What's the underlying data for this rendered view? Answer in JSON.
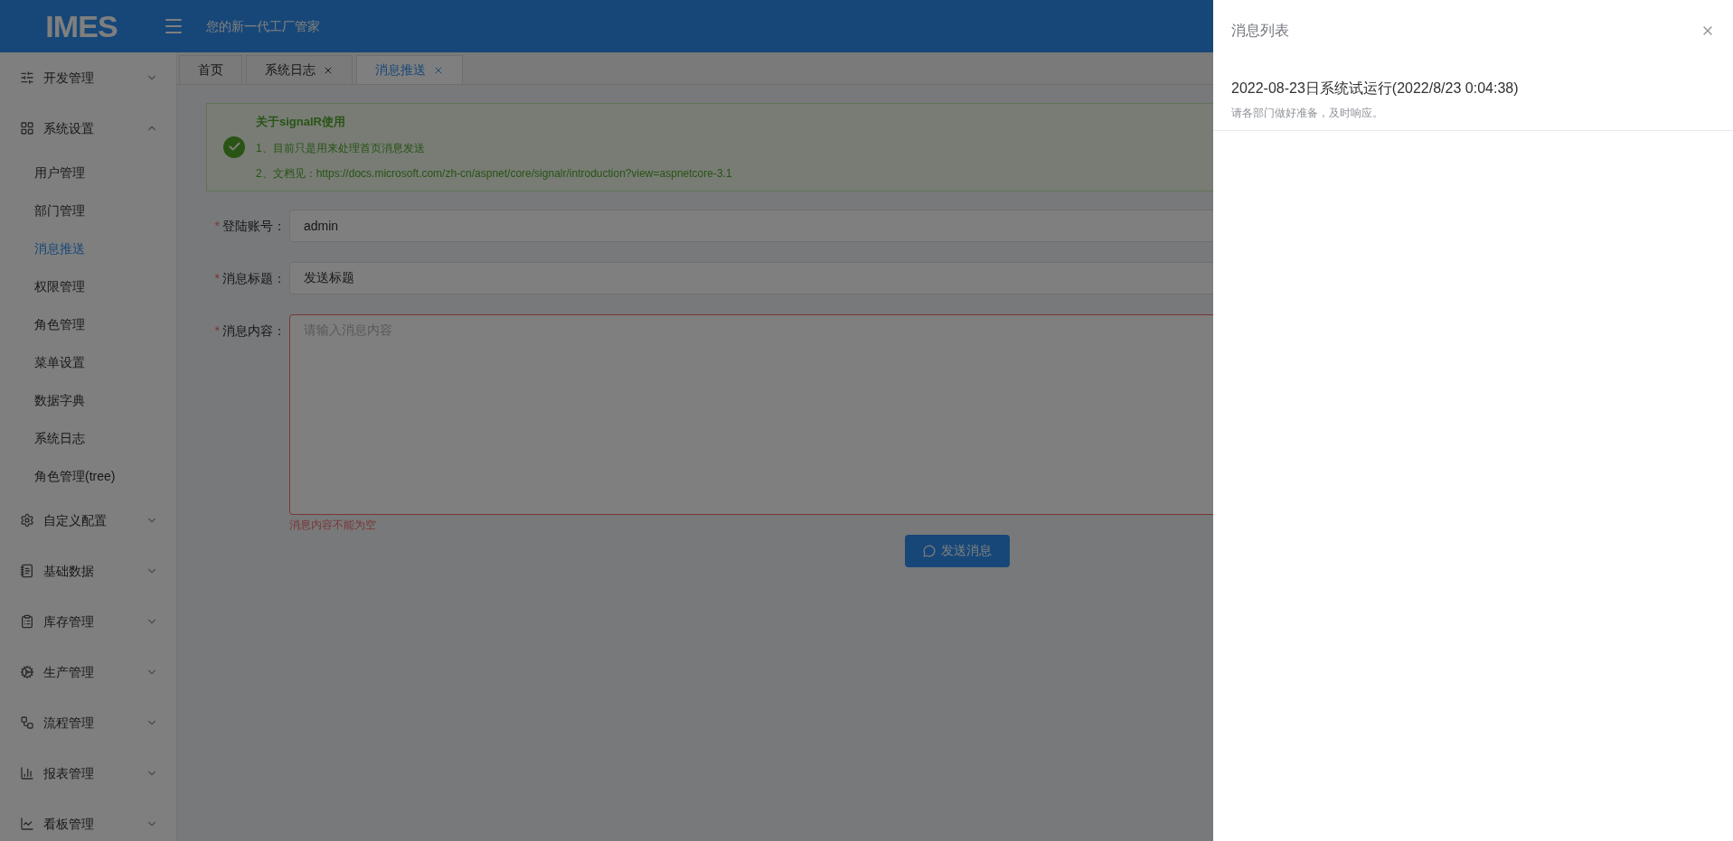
{
  "header": {
    "logo": "IMES",
    "tagline": "您的新一代工厂管家"
  },
  "sidebar": {
    "groups": [
      {
        "label": "开发管理",
        "expanded": false
      },
      {
        "label": "系统设置",
        "expanded": true,
        "children": [
          {
            "label": "用户管理",
            "selected": false
          },
          {
            "label": "部门管理",
            "selected": false
          },
          {
            "label": "消息推送",
            "selected": true
          },
          {
            "label": "权限管理",
            "selected": false
          },
          {
            "label": "角色管理",
            "selected": false
          },
          {
            "label": "菜单设置",
            "selected": false
          },
          {
            "label": "数据字典",
            "selected": false
          },
          {
            "label": "系统日志",
            "selected": false
          },
          {
            "label": "角色管理(tree)",
            "selected": false
          }
        ]
      },
      {
        "label": "自定义配置",
        "expanded": false
      },
      {
        "label": "基础数据",
        "expanded": false
      },
      {
        "label": "库存管理",
        "expanded": false
      },
      {
        "label": "生产管理",
        "expanded": false
      },
      {
        "label": "流程管理",
        "expanded": false
      },
      {
        "label": "报表管理",
        "expanded": false
      },
      {
        "label": "看板管理",
        "expanded": false
      }
    ]
  },
  "tabs": [
    {
      "label": "首页",
      "selected": false,
      "closable": false
    },
    {
      "label": "系统日志",
      "selected": false,
      "closable": true
    },
    {
      "label": "消息推送",
      "selected": true,
      "closable": true
    }
  ],
  "alert": {
    "title": "关于signalR使用",
    "lines": [
      {
        "text": "1、目前只是用来处理首页消息发送"
      },
      {
        "text": "2、文档见：",
        "link": "https://docs.microsoft.com/zh-cn/aspnet/core/signalr/introduction?view=aspnetcore-3.1"
      }
    ]
  },
  "form": {
    "fields": [
      {
        "kind": "input",
        "label": "登陆账号：",
        "required_mark": "*",
        "value": "admin",
        "invalid": false
      },
      {
        "kind": "input",
        "label": "消息标题：",
        "required_mark": "*",
        "value": "发送标题",
        "invalid": false
      },
      {
        "kind": "textarea",
        "label": "消息内容：",
        "required_mark": "*",
        "placeholder": "请输入消息内容",
        "invalid": true,
        "error": "消息内容不能为空"
      }
    ],
    "submit": "发送消息"
  },
  "drawer": {
    "open": true,
    "title": "消息列表",
    "messages": [
      {
        "title": "2022-08-23日系统试运行(2022/8/23 0:04:38)",
        "body": "请各部门做好准备，及时响应。"
      }
    ]
  }
}
